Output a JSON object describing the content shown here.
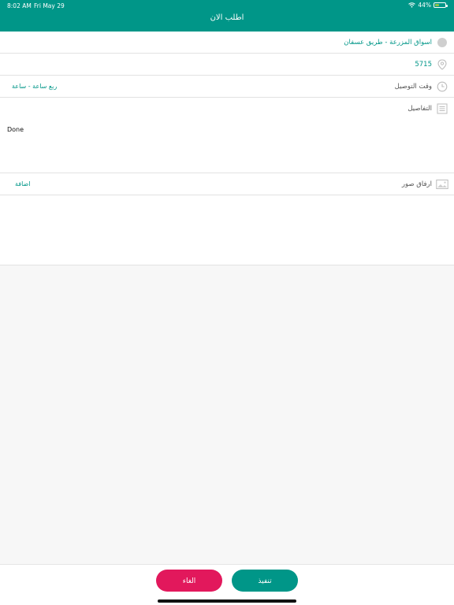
{
  "status_bar": {
    "time": "8:02 AM",
    "date": "Fri May 29",
    "battery": "44%",
    "battery_level": 0.44
  },
  "header": {
    "title": "اطلب الان"
  },
  "form": {
    "location": "اسواق المزرعة - طريق عسفان",
    "code": "5715",
    "delivery_time_label": "وقت التوصيل",
    "delivery_time_value": "ربع ساعة - ساعة",
    "details_label": "التفاصيل",
    "details_text": "Done",
    "attach_photos_label": "ارفاق صور",
    "add_link": "اضافة"
  },
  "actions": {
    "cancel_label": "الغاء",
    "execute_label": "تنفيذ"
  },
  "colors": {
    "primary": "#009688",
    "cancel": "#e2185c"
  }
}
